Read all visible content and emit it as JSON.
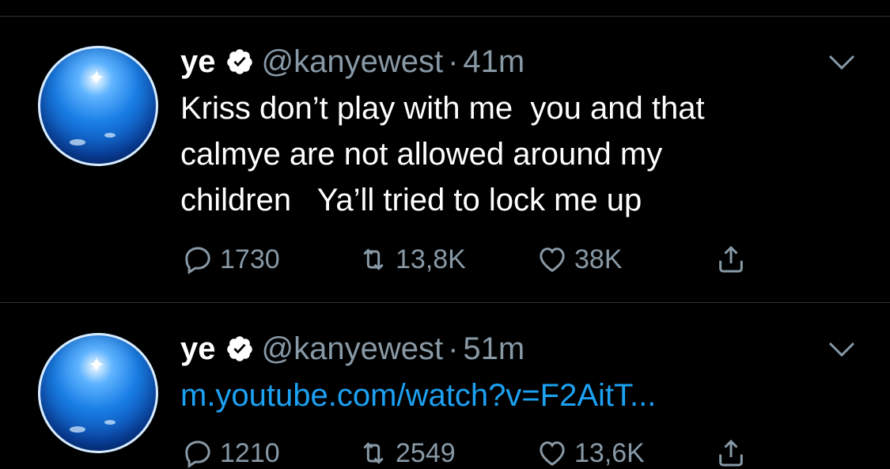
{
  "tweets": [
    {
      "name": "ye",
      "handle": "@kanyewest",
      "separator": "·",
      "time": "41m",
      "text": "Kriss don’t play with me  you and that\ncalmye are not allowed around my\nchildren   Ya’ll tried to lock me up",
      "replies": "1730",
      "retweets": "13,8K",
      "likes": "38K"
    },
    {
      "name": "ye",
      "handle": "@kanyewest",
      "separator": "·",
      "time": "51m",
      "link": "m.youtube.com/watch?v=F2AitT...",
      "replies": "1210",
      "retweets": "2549",
      "likes": "13,6K"
    }
  ],
  "colors": {
    "background": "#000000",
    "secondary_text": "#8899a6",
    "link": "#1da1f2",
    "divider": "#2f3336"
  },
  "icons": [
    "verified-icon",
    "chevron-down-icon",
    "reply-icon",
    "retweet-icon",
    "like-icon",
    "share-icon"
  ]
}
